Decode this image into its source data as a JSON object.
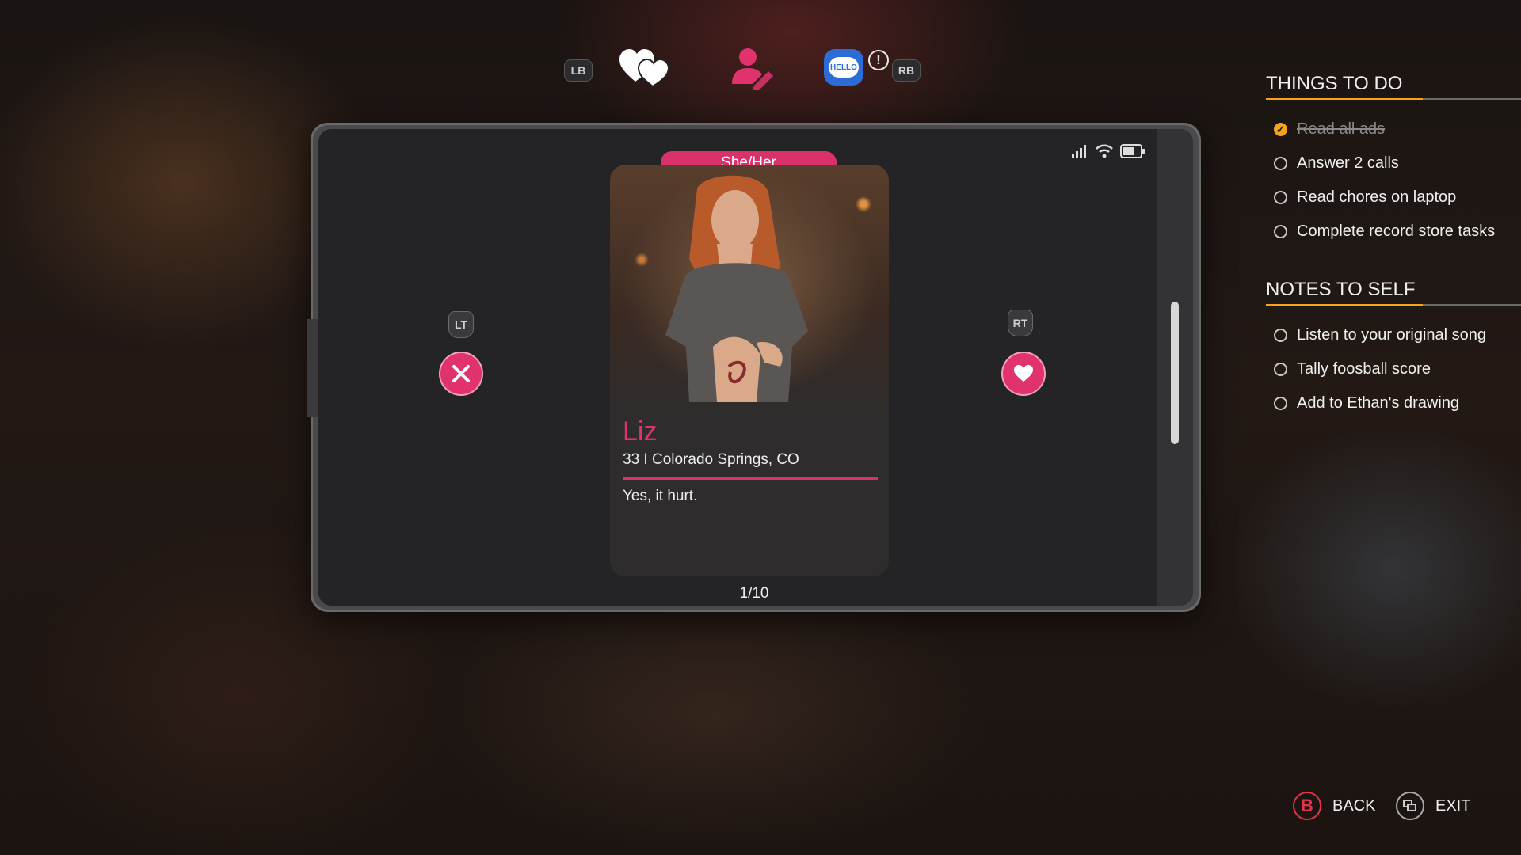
{
  "top_bar": {
    "left_bumper": "LB",
    "right_bumper": "RB",
    "tabs": [
      {
        "icon": "hearts-icon"
      },
      {
        "icon": "profile-edit-icon"
      },
      {
        "icon": "hello-chat-icon",
        "text": "HELLO"
      }
    ],
    "alert": "!"
  },
  "phone": {
    "profile": {
      "pronouns": "She/Her",
      "name": "Liz",
      "meta": "33 I Colorado Springs, CO",
      "bio": "Yes, it hurt."
    },
    "counter": "1/10",
    "left_trigger": "LT",
    "right_trigger": "RT",
    "reject_icon": "x-icon",
    "like_icon": "heart-icon"
  },
  "things_to_do": {
    "title": "THINGS TO DO",
    "items": [
      {
        "label": "Read all ads",
        "done": true
      },
      {
        "label": "Answer 2 calls",
        "done": false
      },
      {
        "label": "Read chores on laptop",
        "done": false
      },
      {
        "label": "Complete record store tasks",
        "done": false
      }
    ]
  },
  "notes_to_self": {
    "title": "NOTES TO SELF",
    "items": [
      {
        "label": "Listen to your original song",
        "done": false
      },
      {
        "label": "Tally foosball score",
        "done": false
      },
      {
        "label": "Add to Ethan's drawing",
        "done": false
      }
    ]
  },
  "prompts": {
    "back_glyph": "B",
    "back": "BACK",
    "exit": "EXIT"
  },
  "colors": {
    "accent_pink": "#e0336e",
    "checkbox_gold": "#f2a51a",
    "hello_blue": "#2d6bd6"
  }
}
